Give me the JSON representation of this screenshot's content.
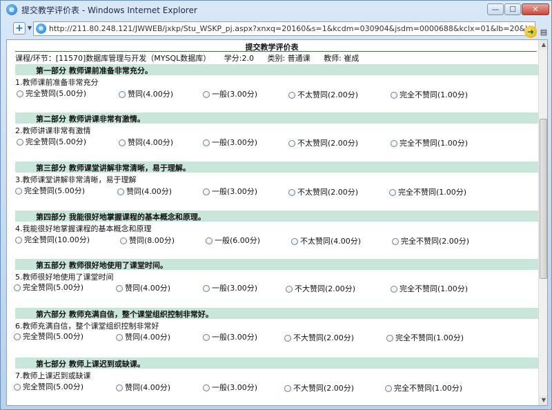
{
  "window": {
    "title": "提交教学评价表 - Windows Internet Explorer",
    "min": "—",
    "max": "☐",
    "close": "✕"
  },
  "address": {
    "url": "http://211.80.248.121/JWWEB/jxkp/Stu_WSKP_pj.aspx?xnxq=20160&s=1&kcdm=030904&jsdm=0000688&kclx=01&lb=20&kclb=0&zj."
  },
  "form": {
    "title": "提交教学评价表",
    "course": "课程/环节：[11570]数据库管理与开发（MYSQL数据库）",
    "credit": "学分:2.0",
    "type": "类别: 普通课",
    "teacher": "教师: 崔成"
  },
  "sections": [
    {
      "title": "第一部分  教师课前准备非常充分。",
      "question": "1.教师课前准备非常充分",
      "options": [
        "完全赞同(5.00分)",
        "赞同(4.00分)",
        "一般(3.00分)",
        "不太赞同(2.00分)",
        "完全不赞同(1.00分)"
      ]
    },
    {
      "title": "第二部分  教师讲课非常有激情。",
      "question": "2.教师讲课非常有激情",
      "options": [
        "完全赞同(5.00分)",
        "赞同(4.00分)",
        "一般(3.00分)",
        "不太赞同(2.00分)",
        "完全不赞同(1.00分)"
      ]
    },
    {
      "title": "第三部分  教师课堂讲解非常清晰，易于理解。",
      "question": "3.教师课堂讲解非常清晰，易于理解",
      "options": [
        "完全赞同(5.00分)",
        "赞同(4.00分)",
        "一般(3.00分)",
        "不太赞同(2.00分)",
        "完全不赞同(1.00分)"
      ]
    },
    {
      "title": "第四部分  我能很好地掌握课程的基本概念和原理。",
      "question": "4.我能很好地掌握课程的基本概念和原理",
      "options": [
        "完全赞同(10.00分)",
        "赞同(8.00分)",
        "一般(6.00分)",
        "不太赞同(4.00分)",
        "完全不赞同(2.00分)"
      ]
    },
    {
      "title": "第五部分  教师很好地使用了课堂时间。",
      "question": "5.教师很好地使用了课堂时间",
      "options": [
        "完全赞同(5.00分)",
        "赞同(4.00分)",
        "一般(3.00分)",
        "不大赞同(2.00分)",
        "完全不赞同(1.00分)"
      ]
    },
    {
      "title": "第六部分  教师充满自信，整个课堂组织控制非常好。",
      "question": "6.教师充满自信，整个课堂组织控制非常好",
      "options": [
        "完全赞同(5.00分)",
        "赞同(4.00分)",
        "一般(3.00分)",
        "不大赞同(2.00分)",
        "完全不赞同(1.00分)"
      ]
    },
    {
      "title": "第七部分  教师上课迟到或缺课。",
      "question": "7.教师上课迟到或缺课",
      "options": [
        "完全赞同(5.00分)",
        "赞同(4.00分)",
        "一般(3.00分)",
        "不大赞同(2.00分)",
        "完全不赞同(1.00分)"
      ]
    }
  ]
}
